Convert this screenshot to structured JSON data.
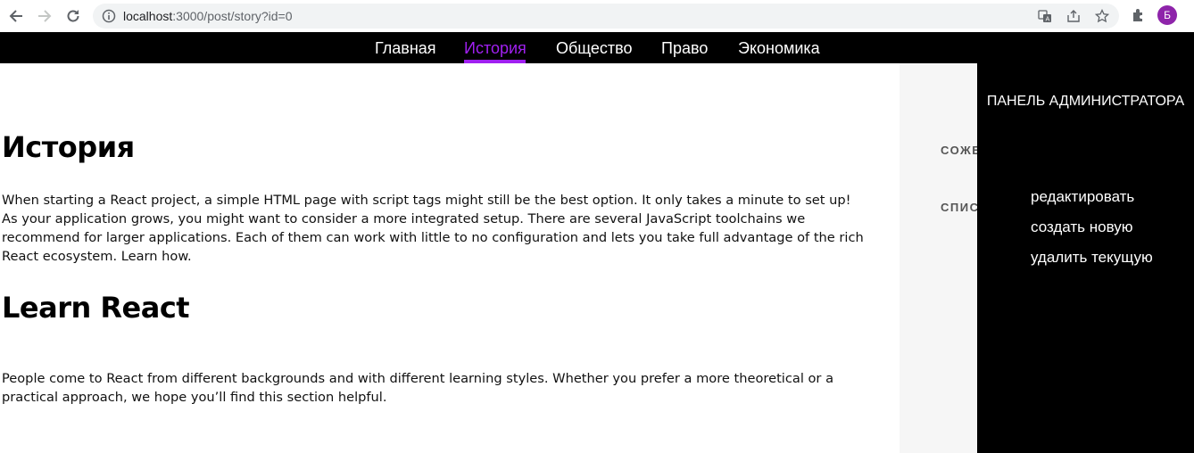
{
  "browser": {
    "url_host": "localhost",
    "url_rest": ":3000/post/story?id=0",
    "avatar_letter": "Б"
  },
  "nav": {
    "items": [
      "Главная",
      "История",
      "Общество",
      "Право",
      "Экономика"
    ],
    "active": "История",
    "active_color": "#a020f0"
  },
  "main": {
    "heading1": "История",
    "para1_line1": "When starting a React project, a simple HTML page with script tags might still be the best option. It only takes a minute to set up!",
    "para1_rest": "As your application grows, you might want to consider a more integrated setup. There are several JavaScript toolchains we recommend for larger applications. Each of them can work with little to no configuration and lets you take full advantage of the rich React ecosystem. Learn how.",
    "heading2": "Learn React",
    "para2": "People come to React from different backgrounds and with different learning styles. Whether you prefer a more theoretical or a practical approach, we hope you’ll find this section helpful."
  },
  "side": {
    "label1": "СОЖЕ",
    "label2": "СПИС"
  },
  "admin": {
    "title": "ПАНЕЛЬ АДМИНИСТРАТОРА",
    "links": [
      "редактировать",
      "создать новую",
      "удалить текущую"
    ]
  }
}
